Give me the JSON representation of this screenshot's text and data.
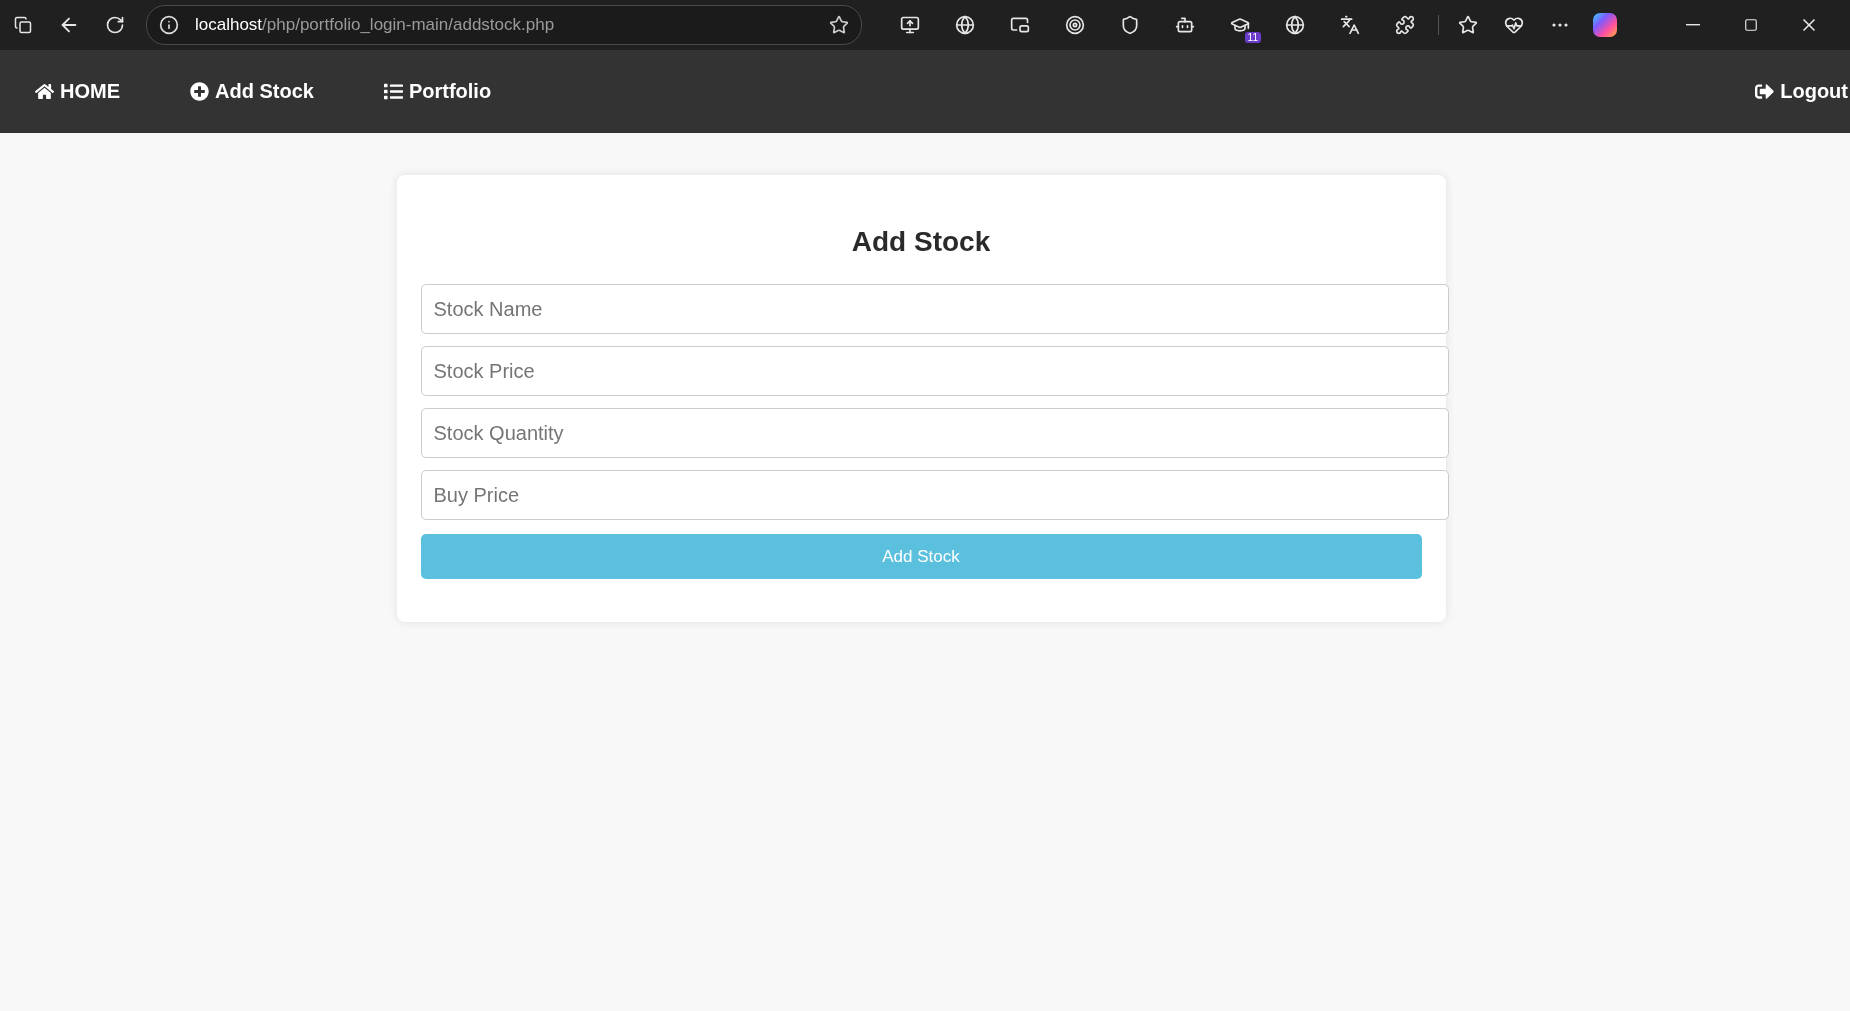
{
  "browser": {
    "url_host": "localhost",
    "url_path": "/php/portfolio_login-main/addstock.php",
    "extensions": [
      {
        "kind": "remote"
      },
      {
        "kind": "grammar"
      },
      {
        "kind": "pip"
      },
      {
        "kind": "target"
      },
      {
        "kind": "shield"
      },
      {
        "kind": "robot"
      },
      {
        "kind": "cap",
        "badge": "11"
      },
      {
        "kind": "globe"
      },
      {
        "kind": "translate"
      },
      {
        "kind": "puzzle"
      }
    ]
  },
  "nav": {
    "items": [
      {
        "label": "HOME"
      },
      {
        "label": "Add Stock"
      },
      {
        "label": "Portfolio"
      }
    ],
    "logout": {
      "label": "Logout"
    }
  },
  "form": {
    "title": "Add Stock",
    "fields": [
      {
        "placeholder": "Stock Name"
      },
      {
        "placeholder": "Stock Price"
      },
      {
        "placeholder": "Stock Quantity"
      },
      {
        "placeholder": "Buy Price"
      }
    ],
    "submit": "Add Stock"
  }
}
